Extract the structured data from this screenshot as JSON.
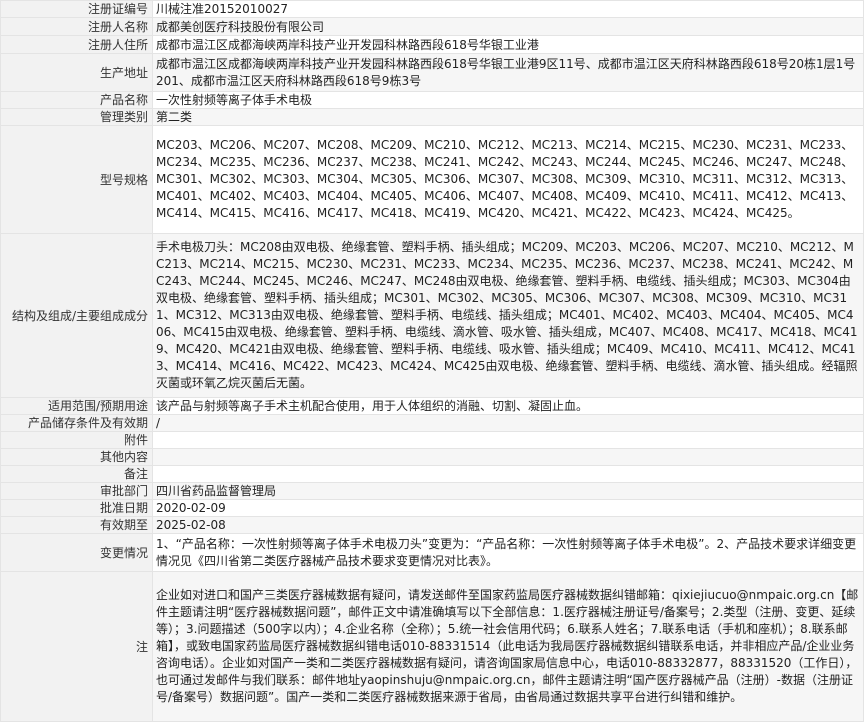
{
  "rows": [
    {
      "label": "注册证编号",
      "value": "川械注准20152010027"
    },
    {
      "label": "注册人名称",
      "value": "成都美创医疗科技股份有限公司"
    },
    {
      "label": "注册人住所",
      "value": "成都市温江区成都海峡两岸科技产业开发园科林路西段618号华银工业港"
    },
    {
      "label": "生产地址",
      "value": "成都市温江区成都海峡两岸科技产业开发园科林路西段618号华银工业港9区11号、成都市温江区天府科林路西段618号20栋1层1号201、成都市温江区天府科林路西段618号9栋3号"
    },
    {
      "label": "产品名称",
      "value": "一次性射频等离子体手术电极"
    },
    {
      "label": "管理类别",
      "value": "第二类"
    },
    {
      "label": "型号规格",
      "value": "MC203、MC206、MC207、MC208、MC209、MC210、MC212、MC213、MC214、MC215、MC230、MC231、MC233、MC234、MC235、MC236、MC237、MC238、MC241、MC242、MC243、MC244、MC245、MC246、MC247、MC248、MC301、MC302、MC303、MC304、MC305、MC306、MC307、MC308、MC309、MC310、MC311、MC312、MC313、MC401、MC402、MC403、MC404、MC405、MC406、MC407、MC408、MC409、MC410、MC411、MC412、MC413、MC414、MC415、MC416、MC417、MC418、MC419、MC420、MC421、MC422、MC423、MC424、MC425。"
    },
    {
      "label": "结构及组成/主要组成成分",
      "value": "手术电极刀头：MC208由双电极、绝缘套管、塑料手柄、插头组成；MC209、MC203、MC206、MC207、MC210、MC212、MC213、MC214、MC215、MC230、MC231、MC233、MC234、MC235、MC236、MC237、MC238、MC241、MC242、MC243、MC244、MC245、MC246、MC247、MC248由双电极、绝缘套管、塑料手柄、电缆线、插头组成；MC303、MC304由双电极、绝缘套管、塑料手柄、插头组成；MC301、MC302、MC305、MC306、MC307、MC308、MC309、MC310、MC311、MC312、MC313由双电极、绝缘套管、塑料手柄、电缆线、插头组成；MC401、MC402、MC403、MC404、MC405、MC406、MC415由双电极、绝缘套管、塑料手柄、电缆线、滴水管、吸水管、插头组成，MC407、MC408、MC417、MC418、MC419、MC420、MC421由双电极、绝缘套管、塑料手柄、电缆线、吸水管、插头组成；MC409、MC410、MC411、MC412、MC413、MC414、MC416、MC422、MC423、MC424、MC425由双电极、绝缘套管、塑料手柄、电缆线、滴水管、插头组成。经辐照灭菌或环氧乙烷灭菌后无菌。"
    },
    {
      "label": "适用范围/预期用途",
      "value": "该产品与射频等离子手术主机配合使用，用于人体组织的消融、切割、凝固止血。"
    },
    {
      "label": "产品储存条件及有效期",
      "value": "/"
    },
    {
      "label": "附件",
      "value": ""
    },
    {
      "label": "其他内容",
      "value": ""
    },
    {
      "label": "备注",
      "value": ""
    },
    {
      "label": "审批部门",
      "value": "四川省药品监督管理局"
    },
    {
      "label": "批准日期",
      "value": "2020-02-09"
    },
    {
      "label": "有效期至",
      "value": "2025-02-08"
    },
    {
      "label": "变更情况",
      "value": "1、“产品名称：一次性射频等离子体手术电极刀头”变更为：“产品名称：一次性射频等离子体手术电极”。2、产品技术要求详细变更情况见《四川省第二类医疗器械产品技术要求变更情况对比表》。"
    },
    {
      "label": "注",
      "value": "企业如对进口和国产三类医疗器械数据有疑问，请发送邮件至国家药监局医疗器械数据纠错邮箱：qixiejiucuo@nmpaic.org.cn【邮件主题请注明“医疗器械数据问题”，邮件正文中请准确填写以下全部信息：1.医疗器械注册证号/备案号；2.类型（注册、变更、延续等）；3.问题描述（500字以内）；4.企业名称（全称）；5.统一社会信用代码；6.联系人姓名；7.联系电话（手机和座机）；8.联系邮箱】，或致电国家药监局医疗器械数据纠错电话010-88331514（此电话为我局医疗器械数据纠错联系电话，并非相应产品/企业业务咨询电话）。企业如对国产一类和二类医疗器械数据有疑问，请咨询国家局信息中心，电话010-88332877，88331520（工作日），也可通过发邮件与我们联系：邮件地址yaopinshuju@nmpaic.org.cn，邮件主题请注明“国产医疗器械产品（注册）-数据（注册证号/备案号）数据问题”。国产一类和二类医疗器械数据来源于省局，由省局通过数据共享平台进行纠错和维护。"
    }
  ]
}
